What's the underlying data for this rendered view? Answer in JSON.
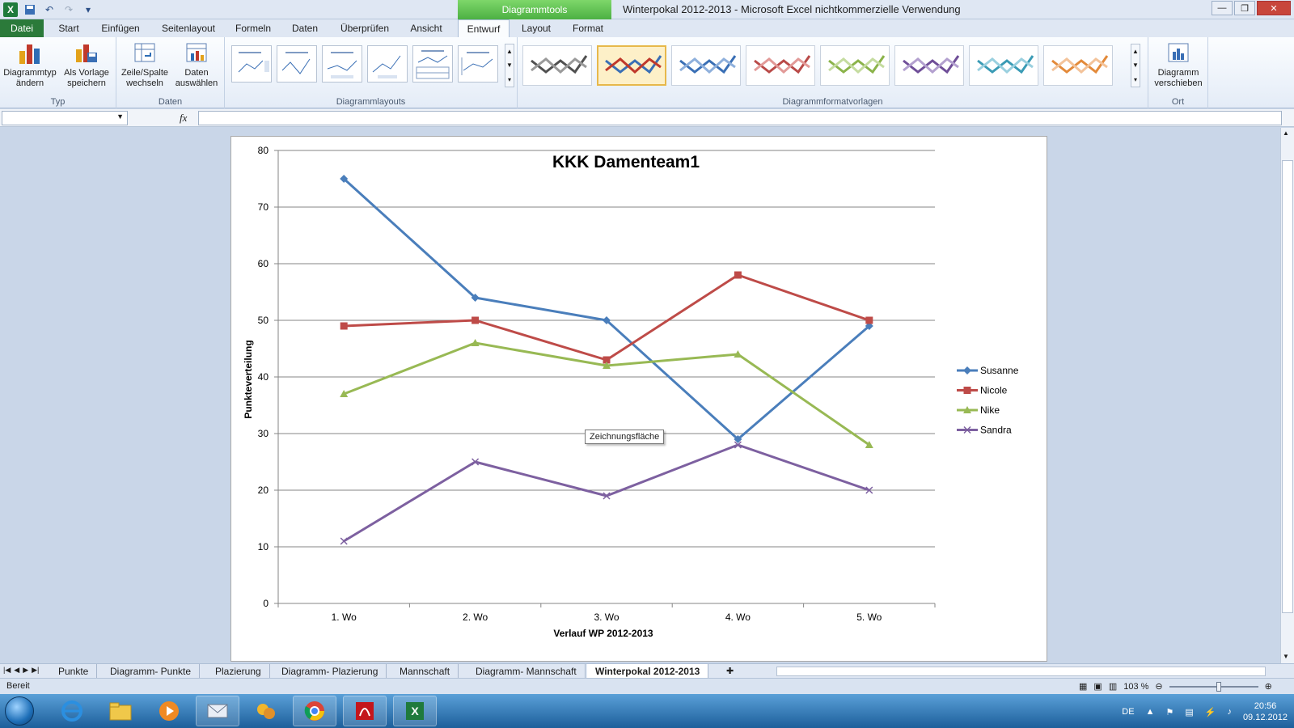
{
  "window": {
    "title": "Winterpokal 2012-2013  -  Microsoft Excel nichtkommerzielle Verwendung",
    "context_header": "Diagrammtools"
  },
  "tabs": [
    "Datei",
    "Start",
    "Einfügen",
    "Seitenlayout",
    "Formeln",
    "Daten",
    "Überprüfen",
    "Ansicht",
    "Entwurf",
    "Layout",
    "Format"
  ],
  "ribbon": {
    "typ": {
      "label": "Typ",
      "change_type": "Diagrammtyp ändern",
      "save_template": "Als Vorlage speichern"
    },
    "daten": {
      "label": "Daten",
      "switch_row_col": "Zeile/Spalte wechseln",
      "select_data": "Daten auswählen"
    },
    "layouts": {
      "label": "Diagrammlayouts"
    },
    "styles": {
      "label": "Diagrammformatvorlagen"
    },
    "ort": {
      "label": "Ort",
      "move_chart": "Diagramm verschieben"
    }
  },
  "formula": {
    "fx": "fx"
  },
  "chart_tooltip": "Zeichnungsfläche",
  "sheet_tabs": [
    "Punkte",
    "Diagramm- Punkte",
    "Plazierung",
    "Diagramm- Plazierung",
    "Mannschaft",
    "Diagramm- Mannschaft",
    "Winterpokal 2012-2013"
  ],
  "status": {
    "ready": "Bereit",
    "zoom": "103 %"
  },
  "taskbar": {
    "lang": "DE",
    "time": "20:56",
    "date": "09.12.2012"
  },
  "chart_data": {
    "type": "line",
    "title": "KKK Damenteam1",
    "xlabel": "Verlauf WP 2012-2013",
    "ylabel": "Punkteverteilung",
    "categories": [
      "1. Wo",
      "2. Wo",
      "3. Wo",
      "4. Wo",
      "5. Wo"
    ],
    "ylim": [
      0,
      80
    ],
    "yticks": [
      0,
      10,
      20,
      30,
      40,
      50,
      60,
      70,
      80
    ],
    "grid": true,
    "legend": "right",
    "series": [
      {
        "name": "Susanne",
        "values": [
          75,
          54,
          50,
          29,
          49
        ],
        "color": "#4a7ebb",
        "marker": "diamond"
      },
      {
        "name": "Nicole",
        "values": [
          49,
          50,
          43,
          58,
          50
        ],
        "color": "#be4b48",
        "marker": "square"
      },
      {
        "name": "Nike",
        "values": [
          37,
          46,
          42,
          44,
          28
        ],
        "color": "#98b954",
        "marker": "triangle"
      },
      {
        "name": "Sandra",
        "values": [
          11,
          25,
          19,
          28,
          20
        ],
        "color": "#7d60a0",
        "marker": "x"
      }
    ]
  }
}
